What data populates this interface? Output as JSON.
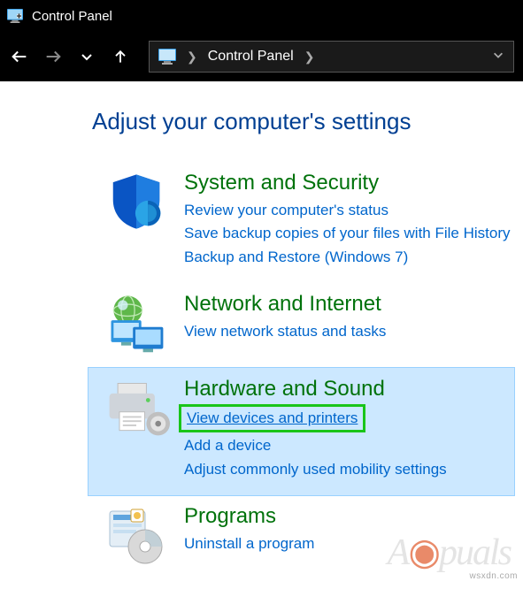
{
  "window": {
    "title": "Control Panel"
  },
  "addressbar": {
    "crumb1": "Control Panel"
  },
  "heading": "Adjust your computer's settings",
  "categories": [
    {
      "title": "System and Security",
      "links": [
        "Review your computer's status",
        "Save backup copies of your files with File History",
        "Backup and Restore (Windows 7)"
      ]
    },
    {
      "title": "Network and Internet",
      "links": [
        "View network status and tasks"
      ]
    },
    {
      "title": "Hardware and Sound",
      "links": [
        "View devices and printers",
        "Add a device",
        "Adjust commonly used mobility settings"
      ]
    },
    {
      "title": "Programs",
      "links": [
        "Uninstall a program"
      ]
    }
  ],
  "watermark_site": "wsxdn.com",
  "watermark_logo": "A puals"
}
